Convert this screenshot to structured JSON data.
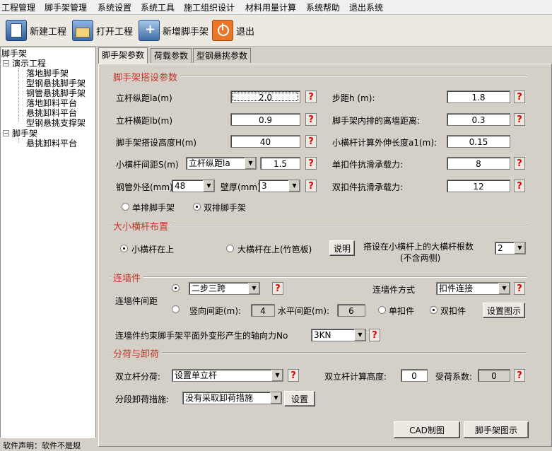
{
  "menubar": {
    "items": [
      "工程管理",
      "脚手架管理",
      "系统设置",
      "系统工具",
      "施工组织设计",
      "材料用量计算",
      "系统帮助",
      "退出系统"
    ]
  },
  "toolbar": {
    "new_project": "新建工程",
    "open_project": "打开工程",
    "add_scaffold": "新增脚手架",
    "exit": "退出"
  },
  "tree": {
    "root": "脚手架",
    "node_demo": "演示工程",
    "demo_children": [
      "落地脚手架",
      "型钢悬挑脚手架",
      "钢管悬挑脚手架",
      "落地卸料平台",
      "悬挑卸料平台",
      "型钢悬挑支撑架"
    ],
    "node_scaffold": "脚手架",
    "scaffold_children": [
      "悬挑卸料平台"
    ]
  },
  "status": {
    "text": "软件声明：软件不是规"
  },
  "tabs": [
    "脚手架参数",
    "荷载参数",
    "型钢悬挑参数"
  ],
  "section1": {
    "title": "脚手架搭设参数",
    "left": [
      {
        "label": "立杆纵距la(m)",
        "value": "2.0"
      },
      {
        "label": "立杆横距lb(m)",
        "value": "0.9"
      },
      {
        "label": "脚手架搭设高度H(m)",
        "value": "40"
      }
    ],
    "right": [
      {
        "label": "步距h (m):",
        "value": "1.8"
      },
      {
        "label": "脚手架内排的离墙距离:",
        "value": "0.3"
      },
      {
        "label": "小横杆计算外伸长度a1(m):",
        "value": "0.15"
      },
      {
        "label": "单扣件抗滑承载力:",
        "value": "8"
      },
      {
        "label": "双扣件抗滑承载力:",
        "value": "12"
      }
    ],
    "spacing_label": "小横杆间距S(m)",
    "spacing_select": "立杆纵距la",
    "spacing_value": "1.5",
    "tube_label": "钢管外径(mm)",
    "tube_value": "48",
    "wall_label": "壁厚(mm)",
    "wall_value": "3",
    "radio_single": "单排脚手架",
    "radio_double": "双排脚手架"
  },
  "section2": {
    "title": "大小横杆布置",
    "radio_small_top": "小横杆在上",
    "radio_large_top": "大横杆在上(竹笆板)",
    "explain_button": "说明",
    "count_label_1": "搭设在小横杆上的大横杆根数",
    "count_label_2": "(不含两侧)",
    "count_value": "2"
  },
  "section3": {
    "title": "连墙件",
    "spacing_label": "连墙件间距",
    "step_option": "二步三跨",
    "vertical_label": "竖向间距(m):",
    "vertical_value": "4",
    "horizontal_label": "水平间距(m):",
    "horizontal_value": "6",
    "method_label": "连墙件方式",
    "method_value": "扣件连接",
    "single_clip": "单扣件",
    "double_clip": "双扣件",
    "diagram_button": "设置图示",
    "axial_label": "连墙件约束脚手架平面外变形产生的轴向力No",
    "axial_value": "3KN"
  },
  "section4": {
    "title": "分荷与卸荷",
    "double_pole_label": "双立杆分荷:",
    "double_pole_value": "设置单立杆",
    "calc_height_label": "双立杆计算高度:",
    "calc_height_value": "0",
    "load_coeff_label": "受荷系数:",
    "load_coeff_value": "0",
    "unload_label": "分段卸荷措施:",
    "unload_value": "没有采取卸荷措施",
    "unload_button": "设置"
  },
  "footer": {
    "cad_button": "CAD制图",
    "scaffold_diagram_button": "脚手架图示"
  },
  "help_mark": "?"
}
